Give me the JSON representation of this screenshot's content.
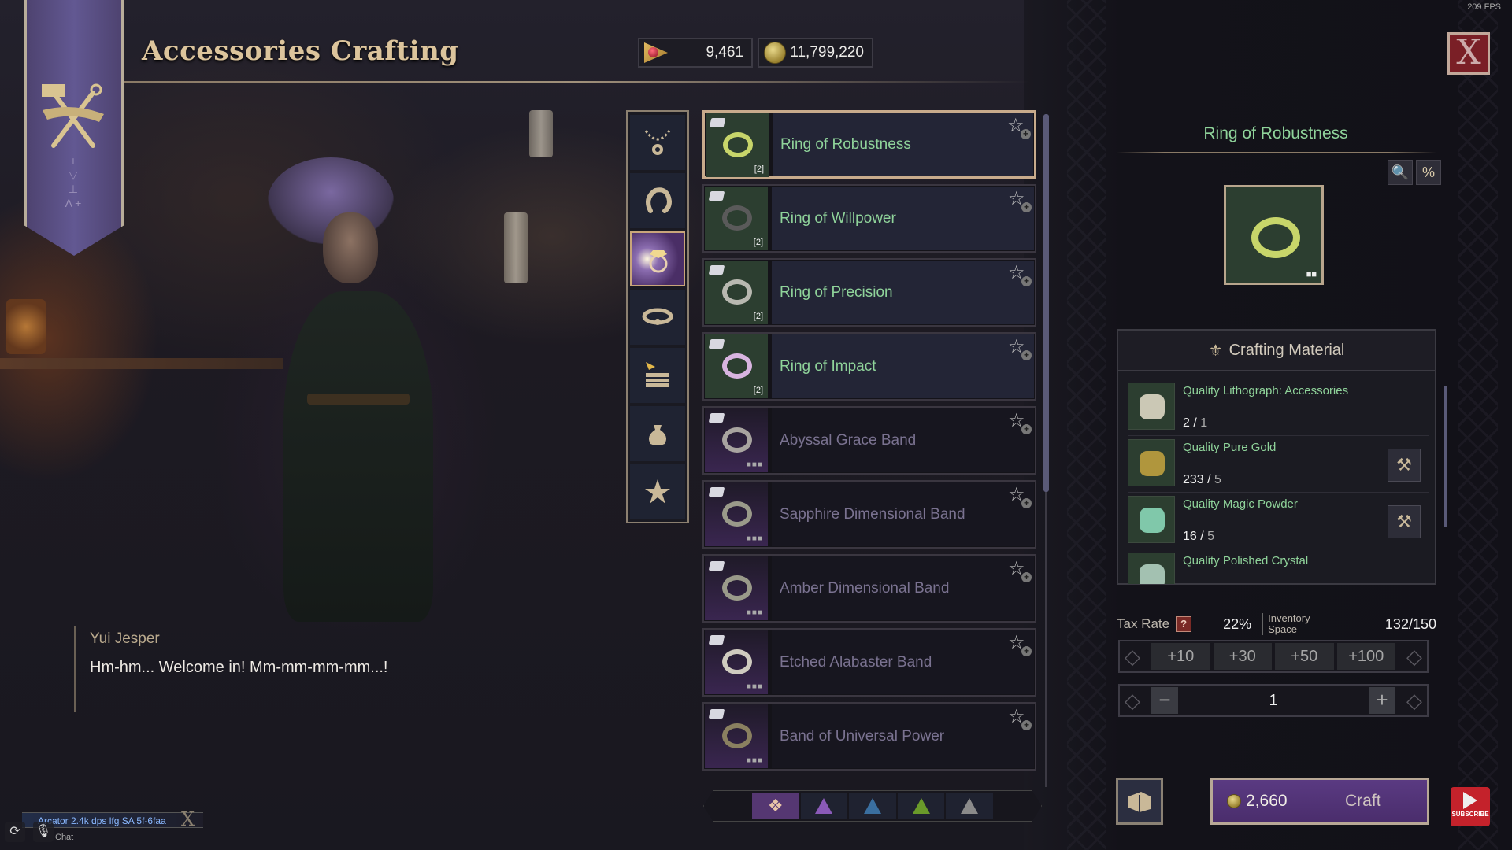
{
  "header": {
    "title": "Accessories Crafting",
    "fps": "209 FPS",
    "currency": [
      {
        "icon": "red-gem-icon",
        "value": "9,461"
      },
      {
        "icon": "gold-coin-icon",
        "value": "11,799,220"
      }
    ],
    "close_label": "X"
  },
  "banner": {
    "runes": "+ ▽ ⊥ Λ +"
  },
  "categories": [
    {
      "name": "Necklace",
      "icon": "necklace-icon",
      "active": false
    },
    {
      "name": "Earring",
      "icon": "earring-icon",
      "active": false
    },
    {
      "name": "Ring",
      "icon": "ring-icon",
      "active": true
    },
    {
      "name": "Belt",
      "icon": "belt-icon",
      "active": false
    },
    {
      "name": "Materials",
      "icon": "crate-icon",
      "active": false
    },
    {
      "name": "Pouch",
      "icon": "pouch-icon",
      "active": false
    },
    {
      "name": "Favorites",
      "icon": "star-icon",
      "active": false
    }
  ],
  "recipes": [
    {
      "name": "Ring of Robustness",
      "state": "owned",
      "selected": true,
      "tier": "[2]",
      "ring_color": "#c7d56a"
    },
    {
      "name": "Ring of Willpower",
      "state": "owned",
      "selected": false,
      "tier": "[2]",
      "ring_color": "#5a5a5a"
    },
    {
      "name": "Ring of Precision",
      "state": "owned",
      "selected": false,
      "tier": "[2]",
      "ring_color": "#b8b8b0"
    },
    {
      "name": "Ring of Impact",
      "state": "owned",
      "selected": false,
      "tier": "[2]",
      "ring_color": "#d8b4e0"
    },
    {
      "name": "Abyssal Grace Band",
      "state": "locked",
      "selected": false,
      "tier": "■■■",
      "ring_color": "#a8a4a0"
    },
    {
      "name": "Sapphire Dimensional Band",
      "state": "locked",
      "selected": false,
      "tier": "■■■",
      "ring_color": "#9a9a8a"
    },
    {
      "name": "Amber Dimensional Band",
      "state": "locked",
      "selected": false,
      "tier": "■■■",
      "ring_color": "#9a9a8a"
    },
    {
      "name": "Etched Alabaster Band",
      "state": "locked",
      "selected": false,
      "tier": "■■■",
      "ring_color": "#cfcbbf"
    },
    {
      "name": "Band of Universal Power",
      "state": "locked",
      "selected": false,
      "tier": "■■■",
      "ring_color": "#8a8060"
    }
  ],
  "grade_filters": [
    {
      "name": "All",
      "color": "#e8c4a8",
      "active": true
    },
    {
      "name": "Epic",
      "color": "#8a5ab8",
      "active": false
    },
    {
      "name": "Rare",
      "color": "#3a6fa0",
      "active": false
    },
    {
      "name": "Uncommon",
      "color": "#6a9a2a",
      "active": false
    },
    {
      "name": "Common",
      "color": "#8a8a8a",
      "active": false
    }
  ],
  "detail": {
    "title": "Ring of Robustness",
    "tools": [
      {
        "icon": "search-icon",
        "glyph": "🔍"
      },
      {
        "icon": "percent-icon",
        "glyph": "%"
      }
    ],
    "materials_header": "Crafting Material",
    "materials": [
      {
        "name": "Quality Lithograph: Accessories",
        "have": "2",
        "need": "1",
        "craftable": false,
        "icon": "scroll-icon"
      },
      {
        "name": "Quality Pure Gold",
        "have": "233",
        "need": "5",
        "craftable": true,
        "icon": "gold-nugget-icon"
      },
      {
        "name": "Quality Magic Powder",
        "have": "16",
        "need": "5",
        "craftable": true,
        "icon": "powder-icon"
      },
      {
        "name": "Quality Polished Crystal",
        "have": "",
        "need": "",
        "craftable": false,
        "icon": "crystal-icon"
      }
    ],
    "tax_label": "Tax Rate",
    "tax_help": "?",
    "tax_value": "22%",
    "inventory_label": "Inventory Space",
    "inventory_value": "132/150",
    "quick_add": [
      "+10",
      "+30",
      "+50",
      "+100"
    ],
    "quantity": "1",
    "minus": "−",
    "plus": "+",
    "craft_cost": "2,660",
    "craft_label": "Craft"
  },
  "dialog": {
    "speaker": "Yui Jesper",
    "line": "Hm-hm... Welcome in! Mm-mm-mm-mm...!"
  },
  "chat": {
    "message": "Arcator  2.4k dps lfg SA 5f-6faa",
    "input_hint": "Chat"
  },
  "overlay": {
    "subscribe_label": "SUBSCRIBE"
  }
}
